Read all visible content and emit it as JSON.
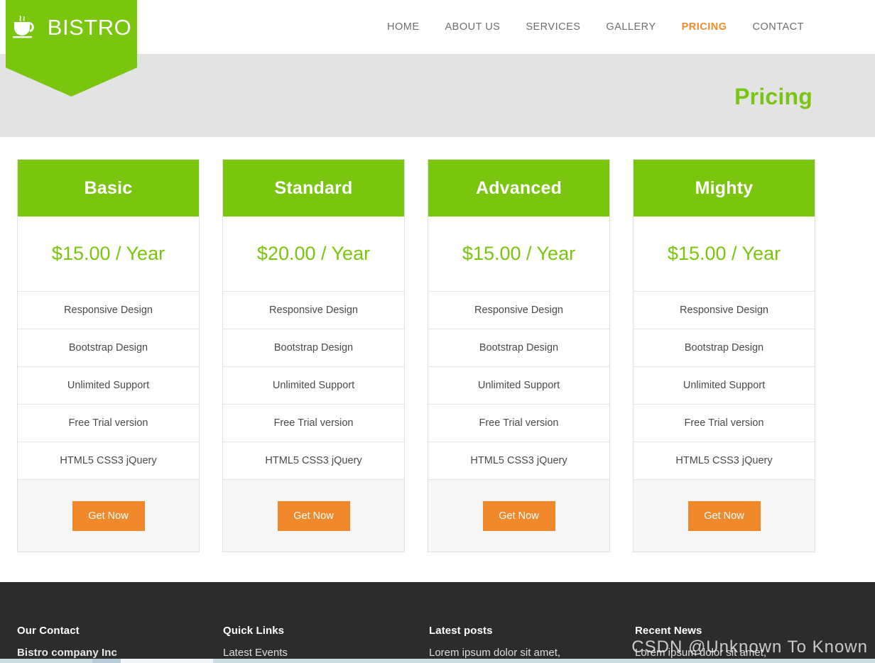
{
  "header": {
    "logo": {
      "text": "BISTRO",
      "icon": "coffee-cup-icon"
    },
    "nav": [
      {
        "label": "HOME",
        "active": false
      },
      {
        "label": "ABOUT US",
        "active": false
      },
      {
        "label": "SERVICES",
        "active": false
      },
      {
        "label": "GALLERY",
        "active": false
      },
      {
        "label": "PRICING",
        "active": true
      },
      {
        "label": "CONTACT",
        "active": false
      }
    ]
  },
  "page": {
    "title": "Pricing"
  },
  "colors": {
    "brand_green": "#7ac50d",
    "accent_orange": "#f0892c",
    "nav_active": "#f08b2c",
    "band_gray": "#e3e3e3",
    "footer_dark": "#2c2c2c",
    "card_foot_gray": "#f7f7f7"
  },
  "pricing": {
    "plans": [
      {
        "name": "Basic",
        "price": "$15.00 / Year",
        "features": [
          "Responsive Design",
          "Bootstrap Design",
          "Unlimited Support",
          "Free Trial version",
          "HTML5 CSS3 jQuery"
        ],
        "cta": "Get Now"
      },
      {
        "name": "Standard",
        "price": "$20.00 / Year",
        "features": [
          "Responsive Design",
          "Bootstrap Design",
          "Unlimited Support",
          "Free Trial version",
          "HTML5 CSS3 jQuery"
        ],
        "cta": "Get Now"
      },
      {
        "name": "Advanced",
        "price": "$15.00 / Year",
        "features": [
          "Responsive Design",
          "Bootstrap Design",
          "Unlimited Support",
          "Free Trial version",
          "HTML5 CSS3 jQuery"
        ],
        "cta": "Get Now"
      },
      {
        "name": "Mighty",
        "price": "$15.00 / Year",
        "features": [
          "Responsive Design",
          "Bootstrap Design",
          "Unlimited Support",
          "Free Trial version",
          "HTML5 CSS3 jQuery"
        ],
        "cta": "Get Now"
      }
    ]
  },
  "footer": {
    "columns": [
      {
        "heading": "Our Contact",
        "first_line": "Bistro company Inc"
      },
      {
        "heading": "Quick Links",
        "first_line": "Latest Events"
      },
      {
        "heading": "Latest posts",
        "first_line": "Lorem ipsum dolor sit amet,"
      },
      {
        "heading": "Recent News",
        "first_line": "Lorem ipsum dolor sit amet,"
      }
    ]
  },
  "watermark": {
    "text": "CSDN @Unknown To Known"
  }
}
